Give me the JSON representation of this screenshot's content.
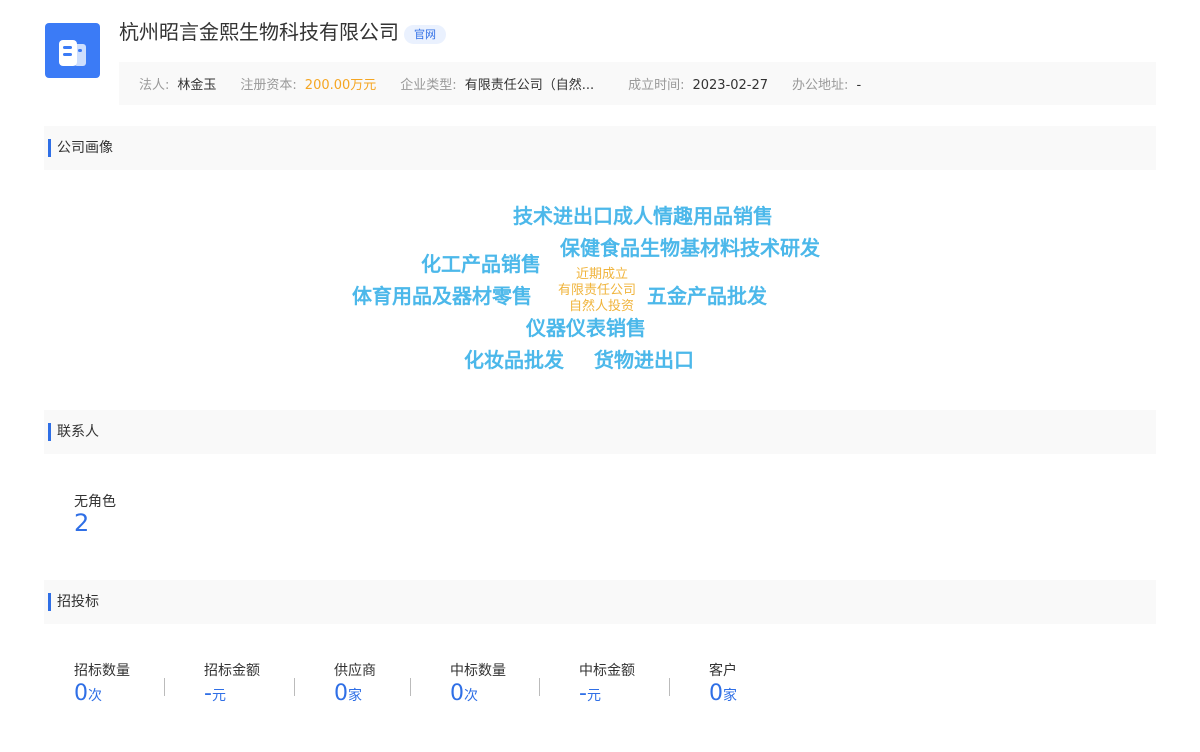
{
  "company": {
    "name": "杭州昭言金熙生物科技有限公司",
    "official_tag": "官网"
  },
  "info": [
    {
      "label": "法人:",
      "value": "林金玉"
    },
    {
      "label": "注册资本:",
      "value": "200.00万元"
    },
    {
      "label": "企业类型:",
      "value": "有限责任公司（自然..."
    },
    {
      "label": "成立时间:",
      "value": "2023-02-27"
    },
    {
      "label": "办公地址:",
      "value": "-"
    }
  ],
  "sections": {
    "portrait": "公司画像",
    "contacts": "联系人",
    "bidding": "招投标"
  },
  "word_cloud": [
    "技术进出口成人情趣用品销售",
    "保健食品生物基材料技术研发",
    "化工产品销售",
    "近期成立",
    "体育用品及器材零售",
    "有限责任公司",
    "五金产品批发",
    "自然人投资",
    "仪器仪表销售",
    "化妆品批发",
    "货物进出口"
  ],
  "contacts": {
    "role_label": "无角色",
    "role_count": "2"
  },
  "bidding_stats": [
    {
      "label": "招标数量",
      "value": "0",
      "unit": "次"
    },
    {
      "label": "招标金额",
      "value": "-",
      "unit": "元"
    },
    {
      "label": "供应商",
      "value": "0",
      "unit": "家"
    },
    {
      "label": "中标数量",
      "value": "0",
      "unit": "次"
    },
    {
      "label": "中标金额",
      "value": "-",
      "unit": "元"
    },
    {
      "label": "客户",
      "value": "0",
      "unit": "家"
    }
  ],
  "colors": {
    "accent": "#2f6fe6",
    "cloud_word": "#4cb8ea",
    "cloud_tag": "#f0b43c",
    "money": "#f5a623"
  }
}
